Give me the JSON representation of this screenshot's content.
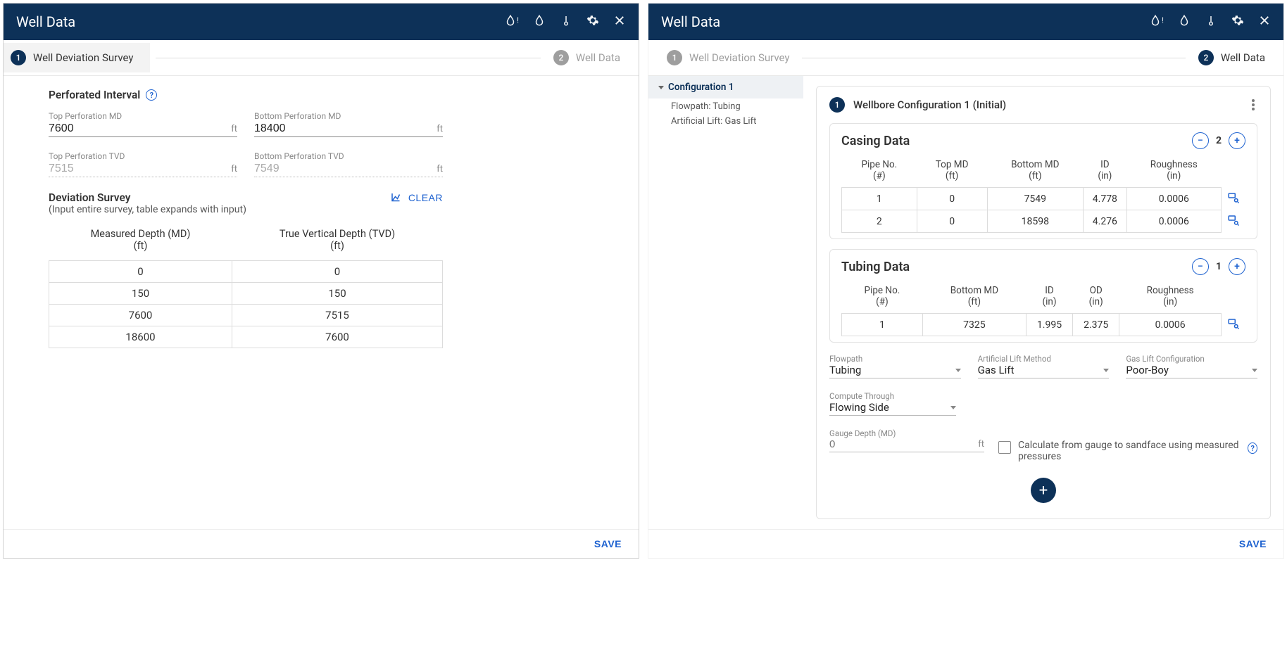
{
  "left": {
    "title": "Well Data",
    "stepper": [
      {
        "num": "1",
        "label": "Well Deviation Survey"
      },
      {
        "num": "2",
        "label": "Well Data"
      }
    ],
    "perf": {
      "section_title": "Perforated Interval",
      "top_md_label": "Top Perforation MD",
      "top_md": "7600",
      "bottom_md_label": "Bottom Perforation MD",
      "bottom_md": "18400",
      "top_tvd_label": "Top Perforation TVD",
      "top_tvd": "7515",
      "bottom_tvd_label": "Bottom Perforation TVD",
      "bottom_tvd": "7549",
      "unit": "ft"
    },
    "dev": {
      "title": "Deviation Survey",
      "hint": "(Input entire survey, table expands with input)",
      "clear": "CLEAR",
      "cols": [
        "Measured Depth (MD)",
        "True Vertical Depth (TVD)"
      ],
      "col_units": "(ft)",
      "rows": [
        {
          "md": "0",
          "tvd": "0"
        },
        {
          "md": "150",
          "tvd": "150"
        },
        {
          "md": "7600",
          "tvd": "7515"
        },
        {
          "md": "18600",
          "tvd": "7600"
        }
      ]
    },
    "save": "SAVE"
  },
  "right": {
    "title": "Well Data",
    "stepper": [
      {
        "num": "1",
        "label": "Well Deviation Survey"
      },
      {
        "num": "2",
        "label": "Well Data"
      }
    ],
    "sidebar": {
      "config_name": "Configuration 1",
      "flowpath_line": "Flowpath: Tubing",
      "lift_line": "Artificial Lift: Gas Lift"
    },
    "card": {
      "step_num": "1",
      "title": "Wellbore Configuration 1 (Initial)"
    },
    "casing": {
      "title": "Casing Data",
      "count": "2",
      "cols": [
        "Pipe No.\n(#)",
        "Top MD\n(ft)",
        "Bottom MD\n(ft)",
        "ID\n(in)",
        "Roughness\n(in)"
      ],
      "rows": [
        {
          "no": "1",
          "top": "0",
          "bottom": "7549",
          "id": "4.778",
          "rough": "0.0006"
        },
        {
          "no": "2",
          "top": "0",
          "bottom": "18598",
          "id": "4.276",
          "rough": "0.0006"
        }
      ]
    },
    "tubing": {
      "title": "Tubing Data",
      "count": "1",
      "cols": [
        "Pipe No.\n(#)",
        "Bottom MD\n(ft)",
        "ID\n(in)",
        "OD\n(in)",
        "Roughness\n(in)"
      ],
      "rows": [
        {
          "no": "1",
          "bottom": "7325",
          "id": "1.995",
          "od": "2.375",
          "rough": "0.0006"
        }
      ]
    },
    "selects": {
      "flowpath_label": "Flowpath",
      "flowpath": "Tubing",
      "lift_label": "Artificial Lift Method",
      "lift": "Gas Lift",
      "gaslift_label": "Gas Lift Configuration",
      "gaslift": "Poor-Boy",
      "compute_label": "Compute Through",
      "compute": "Flowing Side"
    },
    "gauge": {
      "label": "Gauge Depth (MD)",
      "placeholder": "0",
      "unit": "ft",
      "checkbox_text": "Calculate from gauge to sandface using measured pressures"
    },
    "save": "SAVE"
  }
}
